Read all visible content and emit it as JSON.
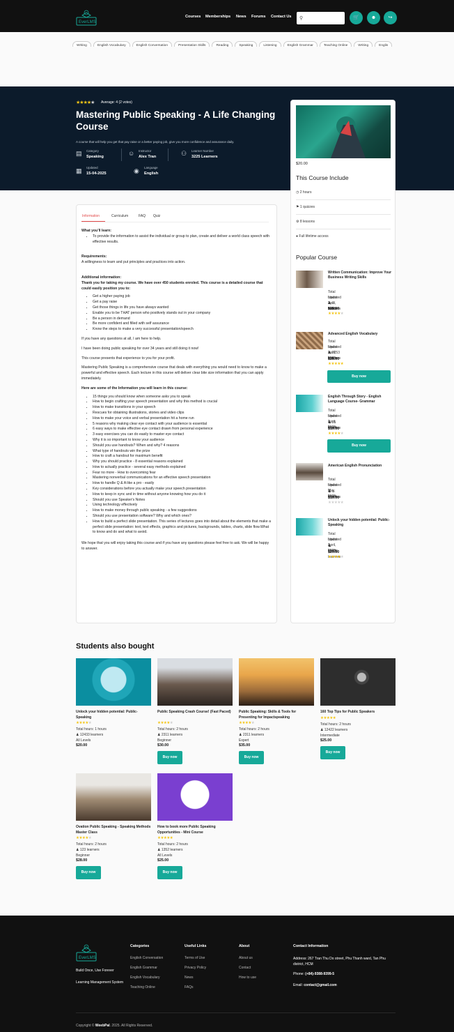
{
  "header": {
    "nav": [
      "Courses",
      "Memberships",
      "News",
      "Forums",
      "Contact Us"
    ],
    "search_placeholder": "",
    "cart_count": "0"
  },
  "tags": [
    "Writing",
    "English Vocabulary",
    "English Conversation",
    "Presentation Skills",
    "Reading",
    "Speaking",
    "Listening",
    "English Grammar",
    "Teaching Online",
    "Writing",
    "Englis"
  ],
  "hero": {
    "rating_text": "Average: 4 (2 votes)",
    "rating": 4,
    "title": "Mastering Public Speaking - A Life Changing Course",
    "subtitle": "A course that will help you get that pay raise or a better paying job, give you more confidence and assurance daily.",
    "meta": [
      {
        "label": "Category",
        "value": "Speaking"
      },
      {
        "label": "Instructor",
        "value": "Alex Tran"
      },
      {
        "label": "Learner Number",
        "value": "3225 Learners"
      },
      {
        "label": "Updated",
        "value": "15-04-2025"
      },
      {
        "label": "Language",
        "value": "English"
      }
    ]
  },
  "sidebar": {
    "price": "$20.00",
    "include_title": "This Course Include",
    "includes": [
      "2 hours",
      "1 quizzes",
      "8 lessons",
      "Full lifetime access"
    ],
    "popular_title": "Popular Course",
    "popular": [
      {
        "title": "Written Communication: Improve Your Business Writing Skills",
        "hours": "Total hours: 2 hours",
        "updated": "Updated April, 2025",
        "learners": "1 learners",
        "price": "$25.00",
        "rating": 4,
        "buy": ""
      },
      {
        "title": "Advanced English Vocabulary",
        "hours": "Total hours: 2 hours",
        "updated": "Updated April, 2025",
        "learners": "2253 learners",
        "price": "$25.00",
        "rating": 5,
        "buy": "Buy now"
      },
      {
        "title": "English Through Story - English Language Course- Grammar",
        "hours": "Total hours: 1 hours",
        "updated": "Updated April, 2025",
        "learners": "25 learners",
        "price": "$10.00",
        "rating": 4,
        "buy": "Buy now"
      },
      {
        "title": "American English Pronunciation",
        "hours": "Total hours: 2 hours",
        "updated": "Updated May, 2025",
        "learners": "1 learners",
        "price": "$10.00",
        "rating": 0,
        "buy": ""
      },
      {
        "title": "Unlock your hidden potential: Public-Speaking",
        "hours": "Total hours: 1 hours",
        "updated": "Updated April, 2025",
        "learners": "12433 learners",
        "price": "$20.00",
        "rating": 4,
        "buy": ""
      }
    ]
  },
  "tabs": [
    "Information",
    "Curriculum",
    "FAQ",
    "Quiz"
  ],
  "info": {
    "learn_h": "What you'll learn:",
    "learn": [
      "To provide the information to assist the individual or group to plan, create and deliver a world class speech with effective results."
    ],
    "req_h": "Requirements:",
    "req": "A willingness to learn and put principles and practices into action.",
    "add_h": "Additional information:",
    "add_b": "Thank you for taking my course. We have over 450 students enroled. This course is a detailed course that could easily position you to:",
    "add_list": [
      "Get a higher paying job",
      "Get a pay raise",
      "Get those things in life you have always wanted",
      "Enable you to be THAT person who positively stands out in your company",
      "Be a person in demand",
      "Be more confident and filled with self assurance",
      "Know the steps to make a very successful presentation/speech"
    ],
    "p1": "If you have any questions at all, I am here to help.",
    "p2": "I have been doing public speaking for over 34 years and still doing it now!",
    "p3": "This course presents that experience to you for your profit.",
    "p4": "Mastering Public Speaking is a comprehensive course that deals with everything you would need to know to make a powerful and effective speech. Each lecture in this course will deliver clear bite size information that you can apply immediately.",
    "learn2_h": "Here are some of the Information you will learn in this course:",
    "learn2": [
      "15 things you should know when someone asks you to speak",
      "How to begin crafting your speech presentation and why this method is crucial",
      "How to make transitions in your speech",
      "Rescues for obtaining illustrations, stories and video clips",
      "How to make your voice and verbal presentation hit a home run",
      "5 reasons why making clear eye contact with your audience is essential",
      "6 easy ways to make effective eye contact drawn from personal experience",
      "3 easy exercises you can do easily to master eye contact",
      "Why it is so important to know your audience",
      "Should you use handouts? When and why? 4 reasons",
      "What type of handouts win the prize",
      "How to craft a handout for maximum benefit",
      "Why you should practice - 8 essential reasons explained",
      "How to actually practice - several easy methods explained",
      "Fear no more - How to overcoming fear",
      "Mastering nonverbal communications for an effective speech presentation",
      "How to handle Q & A like a pro - easily",
      "Key considerations before you actually make your speech presentation",
      "How to keep in sync and in time without anyone knowing how you do it",
      "Should you use Speaker's Notes",
      "Using technology effectively",
      "How to make money through public speaking - a few suggestions",
      "Should you use presentation software? Why and which ones?",
      "How to build a perfect slide presentation. This series of lectures goes into detail about the elements that make a perfect slide presentation: text, text effects, graphics and pictures, backgrounds, tables, charts, slide flow.What to know and do and what to avoid."
    ],
    "p5": "We hope that you will enjoy taking this course and if you have any questions please feel free to ask. We will be happy to answer."
  },
  "also": {
    "title": "Students also bought",
    "items": [
      {
        "title": "Unlock your hidden potential: Public-Speaking",
        "rating": 4,
        "hours": "Total hours: 1 hours",
        "learners": "12433 learners",
        "level": "All Levels",
        "price": "$20.00",
        "buy": ""
      },
      {
        "title": "Public Speaking Crash Course! (Fast Paced)",
        "rating": 4,
        "hours": "Total hours: 2 hours",
        "learners": "2311 learners",
        "level": "Beginner",
        "price": "$30.00",
        "buy": "Buy now"
      },
      {
        "title": "Public Speaking: Skills & Tools for Presenting for Impactspeaking",
        "rating": 4,
        "hours": "Total hours: 2 hours",
        "learners": "2311 learners",
        "level": "Expert",
        "price": "$35.00",
        "buy": "Buy now"
      },
      {
        "title": "160 Top Tips for Public Speakers",
        "rating": 5,
        "hours": "Total hours: 2 hours",
        "learners": "12422 learners",
        "level": "Intermediate",
        "price": "$25.00",
        "buy": "Buy now"
      },
      {
        "title": "Ovation Public Speaking - Speaking Methods Master Class",
        "rating": 4,
        "hours": "Total hours: 2 hours",
        "learners": "123 learners",
        "level": "Beginner",
        "price": "$28.00",
        "buy": "Buy now"
      },
      {
        "title": "How to book more Public Speaking Opportunities - Mini Course",
        "rating": 5,
        "hours": "Total hours: 2 hours",
        "learners": "1352 learners",
        "level": "All Levels",
        "price": "$25.00",
        "buy": "Buy now"
      }
    ]
  },
  "footer": {
    "tagline": "Build Once, Use Forever",
    "tagline2": "Learning Management System",
    "categories_h": "Categories",
    "categories": [
      "English Conversation",
      "English Grammar",
      "English Vocabulary",
      "Teaching Online"
    ],
    "links_h": "Useful Links",
    "links": [
      "Terms of Use",
      "Privacy Policy",
      "News",
      "FAQs"
    ],
    "about_h": "About",
    "about": [
      "About us",
      "Contact",
      "How to use"
    ],
    "contact_h": "Contact Information",
    "address": "Address: 267 Tran Thu Do street, Phu Thanh ward, Tan Phu district, HCM",
    "phone_l": "Phone: ",
    "phone": "(+84)-9388-9399-5",
    "email_l": "Email: ",
    "email": "contact@gmail.com",
    "copy_pre": "Copyright © ",
    "copy_brand": "WeebPal",
    "copy_post": ". 2025. All Rights Reserved."
  },
  "logo_text": "EverLMS",
  "colors": {
    "accent": "#17a999",
    "hero_bg": "#0c1b2b",
    "star": "#f3c516",
    "header_bg": "#111111"
  }
}
